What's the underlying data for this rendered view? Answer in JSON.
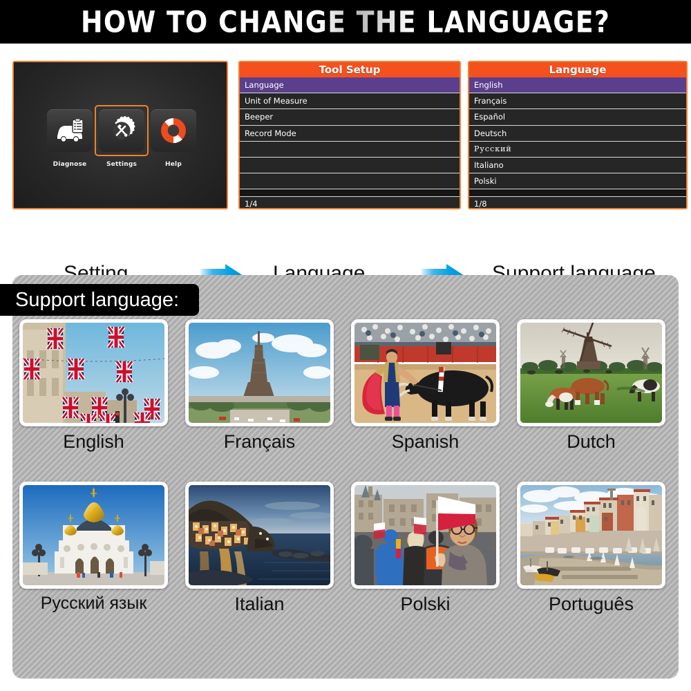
{
  "header": {
    "title": "HOW TO CHANGE THE LANGUAGE?"
  },
  "flow": {
    "captions": {
      "step1": "Setting",
      "step2": "Language",
      "step3": "Support language"
    },
    "arrow_color": "#00a0e4"
  },
  "home_screen": {
    "tiles": [
      {
        "label": "Diagnose",
        "icon": "car-clipboard-icon"
      },
      {
        "label": "Settings",
        "icon": "gear-wrench-screwdriver-icon",
        "selected": true
      },
      {
        "label": "Help",
        "icon": "life-ring-icon"
      }
    ],
    "accent_color": "#f08030"
  },
  "tool_setup_menu": {
    "title": "Tool Setup",
    "rows": [
      {
        "label": "Language",
        "selected": true
      },
      {
        "label": "Unit of Measure",
        "selected": false
      },
      {
        "label": "Beeper",
        "selected": false
      },
      {
        "label": "Record Mode",
        "selected": false
      },
      {
        "label": "",
        "selected": false
      },
      {
        "label": "",
        "selected": false
      },
      {
        "label": "",
        "selected": false
      }
    ],
    "page_indicator": "1/4",
    "title_bg": "#f4511e",
    "selected_bg": "#5b3f8c"
  },
  "language_menu": {
    "title": "Language",
    "rows": [
      {
        "label": "English",
        "selected": true,
        "script": "latin"
      },
      {
        "label": "Français",
        "selected": false,
        "script": "latin"
      },
      {
        "label": "Español",
        "selected": false,
        "script": "latin"
      },
      {
        "label": "Deutsch",
        "selected": false,
        "script": "latin"
      },
      {
        "label": "Русский",
        "selected": false,
        "script": "cyrillic"
      },
      {
        "label": "Italiano",
        "selected": false,
        "script": "latin"
      },
      {
        "label": "Polski",
        "selected": false,
        "script": "latin"
      }
    ],
    "page_indicator": "1/8",
    "title_bg": "#f4511e",
    "selected_bg": "#5b3f8c"
  },
  "support_section": {
    "label": "Support language:",
    "panel_color": "#adadad",
    "cards": [
      {
        "name": "English",
        "photo": "london-street-union-jack-flags"
      },
      {
        "name": "Français",
        "photo": "eiffel-tower-paris"
      },
      {
        "name": "Spanish",
        "photo": "bullfighter-matador-and-bull"
      },
      {
        "name": "Dutch",
        "photo": "dutch-windmill-with-grazing-cows"
      },
      {
        "name": "Русский язык",
        "photo": "moscow-cathedral-golden-domes"
      },
      {
        "name": "Italian",
        "photo": "cinque-terre-coastal-village-at-dusk"
      },
      {
        "name": "Polski",
        "photo": "woman-waving-polish-flag-in-krakow-square"
      },
      {
        "name": "Português",
        "photo": "porto-riverside-douro"
      }
    ]
  }
}
